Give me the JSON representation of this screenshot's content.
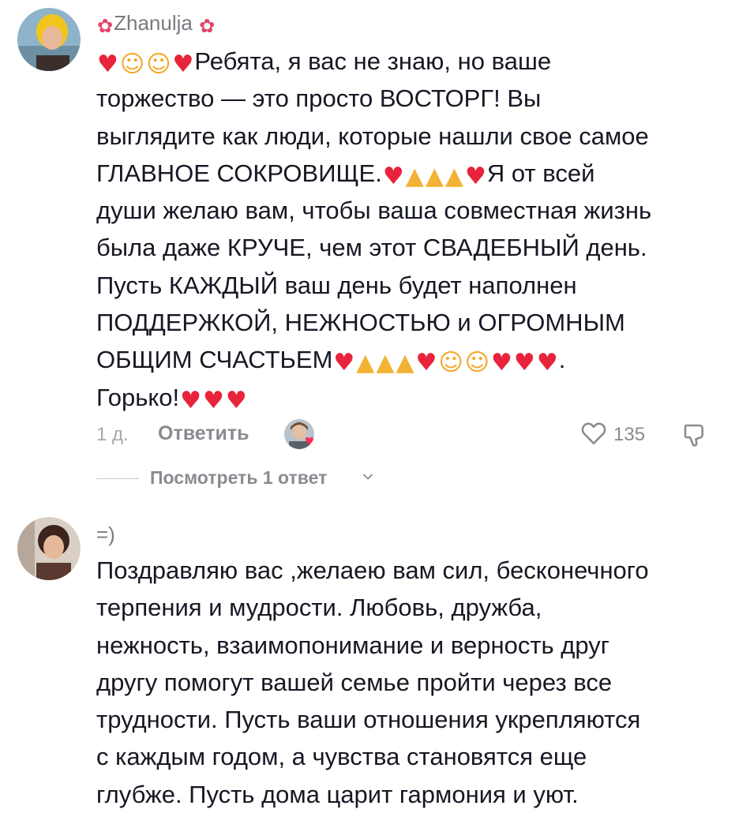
{
  "comments": [
    {
      "username": "Zhanulja",
      "username_prefix_icon": "hibiscus-icon",
      "username_suffix_icon": "hibiscus-icon",
      "lines": [
        "Ребята, я вас не знаю, но ваше",
        "торжество — это просто ВОСТОРГ! Вы",
        "выглядите как люди, которые нашли свое самое",
        "ГЛАВНОЕ СОКРОВИЩЕ.",
        "Я от всей",
        "души желаю вам, чтобы ваша совместная жизнь",
        "была даже КРУЧЕ, чем этот СВАДЕБНЫЙ день.",
        "Пусть КАЖДЫЙ ваш день будет наполнен",
        "ПОДДЕРЖКОЙ, НЕЖНОСТЬЮ и ОГРОМНЫМ",
        "ОБЩИМ СЧАСТЬЕМ",
        ".",
        "Горько!"
      ],
      "time": "1 д.",
      "reply_label": "Ответить",
      "like_count": "135",
      "view_replies_label": "Посмотреть 1 ответ"
    },
    {
      "username": "=)",
      "lines": [
        "Поздравляю вас ,желаею вам сил, бесконечного",
        "терпения и мудрости. Любовь, дружба,",
        "нежность, взаимопонимание и верность друг",
        "другу помогут вашей семье пройти через все",
        "трудности. Пусть ваши отношения укрепляются",
        "с каждым годом, а чувства становятся еще",
        "глубже. Пусть дома царит гармония и уют."
      ]
    }
  ],
  "colors": {
    "heart": "#e8233c",
    "like_red": "#fe2c55",
    "muted": "#8a8b91",
    "text": "#161823"
  }
}
